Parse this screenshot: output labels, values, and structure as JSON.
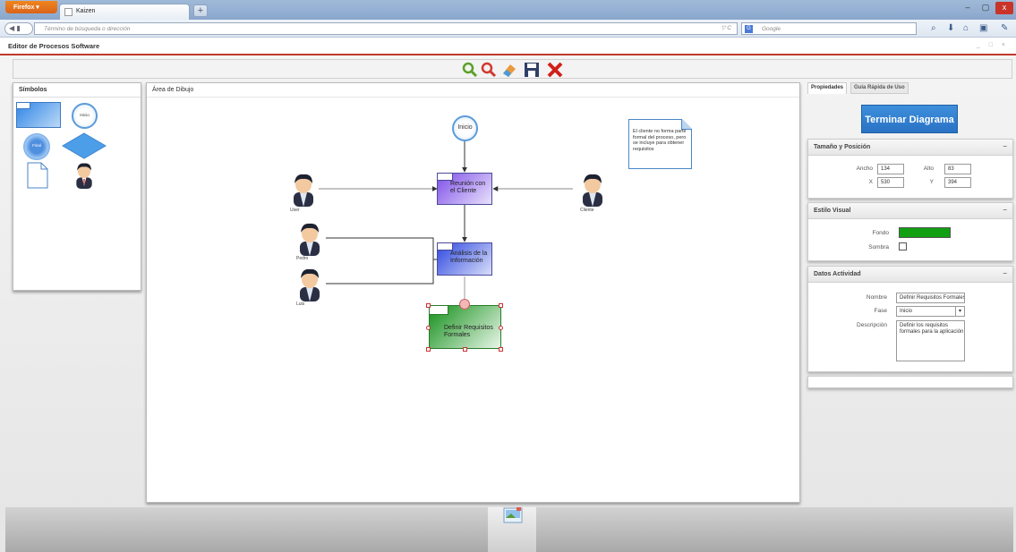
{
  "browser": {
    "menu_label": "Firefox",
    "tab_title": "Kaizen",
    "new_tab": "+",
    "url_placeholder": "Término de búsqueda o dirección",
    "url_tools": "▽ C",
    "search_placeholder": "Google",
    "search_engine_icon": "G",
    "window_buttons": [
      "–",
      "▢",
      "x"
    ],
    "nav_icons": [
      "search-mag-icon",
      "download-icon",
      "home-icon",
      "bookmarks-icon",
      "addon-icon"
    ]
  },
  "app": {
    "title": "Editor de Procesos Software",
    "window_controls": "_ □ ×"
  },
  "toolbar": {
    "tools": [
      {
        "name": "zoom-in-icon",
        "color": "#5aa12a"
      },
      {
        "name": "zoom-out-icon",
        "color": "#d03a2f"
      },
      {
        "name": "eraser-icon",
        "color": "#e89a3c"
      },
      {
        "name": "save-icon",
        "color": "#2f3f66"
      },
      {
        "name": "delete-icon",
        "color": "#d0201a"
      }
    ]
  },
  "symbols": {
    "title": "Símbolos",
    "items": [
      {
        "name": "activity-symbol"
      },
      {
        "name": "start-symbol",
        "label": "Inicio"
      },
      {
        "name": "end-symbol",
        "label": "Final"
      },
      {
        "name": "decision-symbol"
      },
      {
        "name": "note-symbol"
      },
      {
        "name": "actor-symbol"
      }
    ]
  },
  "canvas": {
    "title": "Área de Dibujo",
    "start_label": "Inicio",
    "note_text": "El cliente no forma parte formal del proceso, pero se incluye para obtener requisitos",
    "activities": [
      {
        "id": "reunion",
        "label": "Reunión con el Cliente",
        "color": "#9a6cf0"
      },
      {
        "id": "analisis",
        "label": "Análisis de la Información",
        "color": "#4f6df0"
      },
      {
        "id": "definir",
        "label": "Definir Requisitos Formales",
        "color": "#2ba32b"
      }
    ],
    "actors": [
      {
        "id": "user",
        "label": "User"
      },
      {
        "id": "cliente",
        "label": "Cliente"
      },
      {
        "id": "pedro",
        "label": "Pedro"
      },
      {
        "id": "luis",
        "label": "Luis"
      }
    ]
  },
  "properties": {
    "tabs": [
      "Propiedades",
      "Guía Rápida de Uso"
    ],
    "finish_button": "Terminar Diagrama",
    "size_section": {
      "title": "Tamaño y Posición",
      "collapse": "–",
      "ancho_label": "Ancho",
      "ancho_value": "134",
      "alto_label": "Alto",
      "alto_value": "83",
      "x_label": "X",
      "x_value": "530",
      "y_label": "Y",
      "y_value": "394"
    },
    "style_section": {
      "title": "Estilo Visual",
      "collapse": "–",
      "fondo_label": "Fondo",
      "fondo_color": "#11a011",
      "sombra_label": "Sombra"
    },
    "activity_section": {
      "title": "Datos Actividad",
      "collapse": "–",
      "nombre_label": "Nombre",
      "nombre_value": "Definir Requisitos Formales",
      "fase_label": "Fase",
      "fase_value": "Inicio",
      "descripcion_label": "Descripción",
      "descripcion_value": "Definir los requisitos formales para la aplicación"
    }
  }
}
